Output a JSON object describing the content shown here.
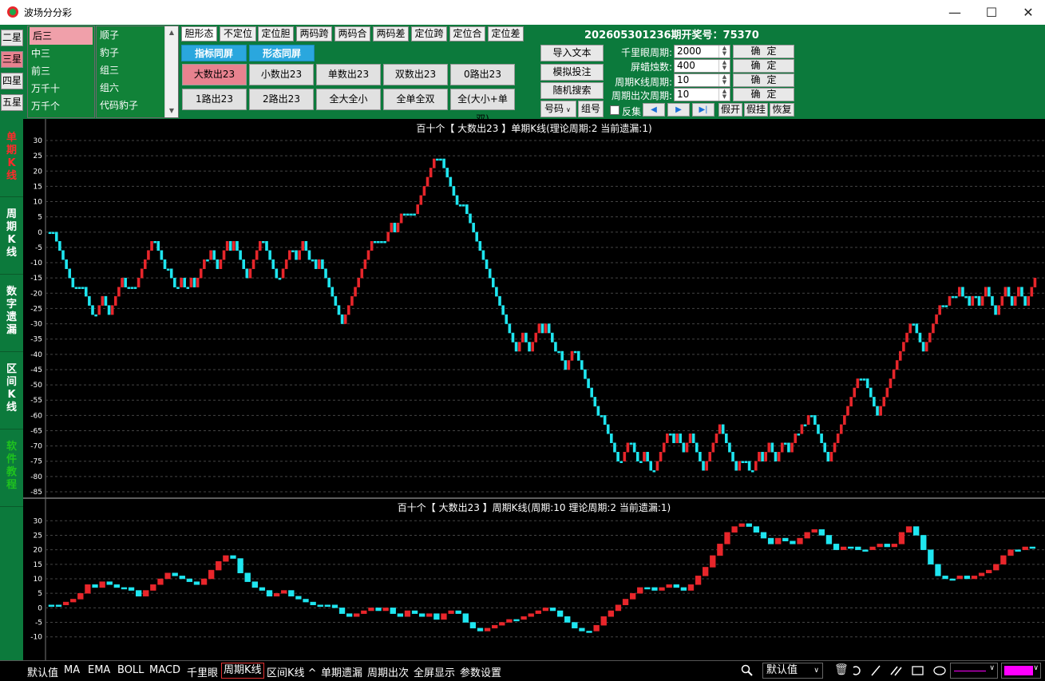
{
  "window": {
    "title": "波场分分彩",
    "min": "—",
    "max": "☐",
    "close": "✕"
  },
  "stars": [
    "二星",
    "三星",
    "四星",
    "五星"
  ],
  "list1": [
    "后三",
    "中三",
    "前三",
    "万千十",
    "万千个"
  ],
  "list2": [
    "顺子",
    "豹子",
    "组三",
    "组六",
    "代码豹子"
  ],
  "tabs": [
    "胆形态",
    "不定位",
    "定位胆",
    "两码跨",
    "两码合",
    "两码差",
    "定位跨",
    "定位合",
    "定位差"
  ],
  "blue_buttons": [
    "指标同屏",
    "形态同屏"
  ],
  "grid_buttons": [
    [
      "大数出23",
      "小数出23",
      "单数出23",
      "双数出23",
      "0路出23"
    ],
    [
      "1路出23",
      "2路出23",
      "全大全小",
      "全单全双",
      "全(大小+单双)"
    ]
  ],
  "period_label": "202605301236期开奖号：75370",
  "right_buttons": {
    "import": "导入文本",
    "simulate": "模拟投注",
    "random": "随机搜索",
    "number": "号码",
    "group": "组号"
  },
  "settings": [
    {
      "label": "千里眼周期:",
      "value": "2000",
      "ok": "确定"
    },
    {
      "label": "屏蜡烛数:",
      "value": "400",
      "ok": "确定"
    },
    {
      "label": "周期K线周期:",
      "value": "10",
      "ok": "确定"
    },
    {
      "label": "周期出次周期:",
      "value": "10",
      "ok": "确定"
    }
  ],
  "reverse_label": "反集",
  "small_buttons": [
    "假开",
    "假挂",
    "恢复"
  ],
  "vtabs": [
    {
      "label": "单期K线",
      "color": "#ff2b2b"
    },
    {
      "label": "周期K线",
      "color": "#ffffff"
    },
    {
      "label": "数字遗漏",
      "color": "#ffffff"
    },
    {
      "label": "区间K线",
      "color": "#ffffff"
    },
    {
      "label": "软件教程",
      "color": "#1fc21f"
    }
  ],
  "colors": {
    "up": "#e8262b",
    "down": "#1fe6f0",
    "grid": "#444444",
    "axis": "#ffffff"
  },
  "chart_data": [
    {
      "type": "line",
      "title": "百十个【 大数出23 】单期K线(理论周期:2 当前遗漏:1)",
      "ylim": [
        -85,
        30
      ],
      "yticks": [
        30,
        25,
        20,
        15,
        10,
        5,
        0,
        -5,
        -10,
        -15,
        -20,
        -25,
        -30,
        -35,
        -40,
        -45,
        -50,
        -55,
        -60,
        -65,
        -70,
        -75,
        -80,
        -85
      ],
      "series": [
        {
          "values": [
            0,
            0,
            -3,
            -6,
            -9,
            -12,
            -15,
            -18,
            -18,
            -18,
            -18,
            -21,
            -24,
            -27,
            -27,
            -24,
            -21,
            -24,
            -27,
            -24,
            -21,
            -18,
            -15,
            -18,
            -18,
            -18,
            -18,
            -15,
            -12,
            -9,
            -6,
            -3,
            -3,
            -6,
            -9,
            -12,
            -12,
            -15,
            -18,
            -18,
            -15,
            -18,
            -18,
            -15,
            -18,
            -15,
            -12,
            -9,
            -9,
            -6,
            -9,
            -12,
            -9,
            -6,
            -3,
            -6,
            -3,
            -6,
            -9,
            -12,
            -15,
            -12,
            -9,
            -6,
            -3,
            -3,
            -6,
            -9,
            -12,
            -15,
            -15,
            -12,
            -9,
            -6,
            -6,
            -9,
            -6,
            -3,
            -6,
            -9,
            -9,
            -12,
            -9,
            -12,
            -15,
            -18,
            -21,
            -24,
            -27,
            -30,
            -27,
            -24,
            -21,
            -18,
            -15,
            -12,
            -9,
            -6,
            -3,
            -3,
            -3,
            -3,
            -3,
            0,
            3,
            0,
            3,
            6,
            6,
            6,
            6,
            6,
            9,
            12,
            15,
            18,
            21,
            24,
            24,
            24,
            21,
            18,
            15,
            12,
            9,
            9,
            9,
            6,
            3,
            0,
            -3,
            -6,
            -9,
            -12,
            -15,
            -18,
            -21,
            -24,
            -27,
            -30,
            -33,
            -36,
            -39,
            -36,
            -33,
            -36,
            -39,
            -36,
            -33,
            -30,
            -33,
            -30,
            -33,
            -36,
            -39,
            -39,
            -42,
            -45,
            -42,
            -39,
            -39,
            -42,
            -45,
            -48,
            -51,
            -54,
            -57,
            -60,
            -60,
            -63,
            -66,
            -69,
            -72,
            -75,
            -75,
            -72,
            -69,
            -69,
            -72,
            -75,
            -75,
            -72,
            -75,
            -78,
            -78,
            -75,
            -72,
            -69,
            -66,
            -66,
            -69,
            -66,
            -69,
            -72,
            -69,
            -66,
            -69,
            -72,
            -75,
            -78,
            -75,
            -72,
            -69,
            -66,
            -63,
            -66,
            -69,
            -72,
            -75,
            -78,
            -75,
            -75,
            -75,
            -78,
            -78,
            -75,
            -72,
            -75,
            -72,
            -69,
            -72,
            -75,
            -72,
            -69,
            -69,
            -72,
            -69,
            -66,
            -66,
            -63,
            -63,
            -60,
            -60,
            -63,
            -66,
            -69,
            -72,
            -75,
            -72,
            -69,
            -66,
            -63,
            -60,
            -57,
            -54,
            -51,
            -48,
            -48,
            -48,
            -51,
            -54,
            -57,
            -60,
            -57,
            -54,
            -51,
            -48,
            -45,
            -42,
            -39,
            -36,
            -33,
            -30,
            -30,
            -33,
            -36,
            -39,
            -36,
            -33,
            -30,
            -27,
            -24,
            -24,
            -24,
            -21,
            -21,
            -21,
            -18,
            -21,
            -21,
            -24,
            -21,
            -21,
            -24,
            -21,
            -18,
            -21,
            -24,
            -27,
            -24,
            -21,
            -18,
            -21,
            -24,
            -21,
            -18,
            -21,
            -24,
            -21,
            -18,
            -15
          ]
        }
      ]
    },
    {
      "type": "line",
      "title": "百十个【 大数出23 】周期K线(周期:10 理论周期:2 当前遗漏:1)",
      "ylim": [
        -12,
        32
      ],
      "yticks": [
        30,
        25,
        20,
        15,
        10,
        5,
        0,
        -5,
        -10
      ],
      "series": [
        {
          "values": [
            1,
            1,
            2,
            3,
            5,
            8,
            7,
            9,
            8,
            7,
            7,
            6,
            4,
            6,
            8,
            10,
            12,
            11,
            10,
            9,
            8,
            10,
            13,
            16,
            18,
            17,
            12,
            9,
            7,
            6,
            4,
            5,
            6,
            4,
            3,
            2,
            1,
            1,
            1,
            0,
            -2,
            -3,
            -2,
            -1,
            0,
            -1,
            0,
            -2,
            -3,
            -1,
            -2,
            -3,
            -2,
            -4,
            -2,
            -1,
            -2,
            -5,
            -7,
            -8,
            -7,
            -6,
            -5,
            -4,
            -4,
            -3,
            -2,
            -1,
            0,
            -1,
            -3,
            -5,
            -7,
            -8,
            -8,
            -6,
            -3,
            -1,
            1,
            3,
            5,
            7,
            7,
            6,
            7,
            8,
            7,
            6,
            8,
            11,
            14,
            18,
            22,
            26,
            28,
            29,
            28,
            26,
            24,
            22,
            24,
            23,
            22,
            24,
            26,
            27,
            25,
            22,
            20,
            21,
            21,
            20,
            20,
            21,
            22,
            21,
            22,
            26,
            28,
            25,
            20,
            15,
            11,
            10,
            10,
            11,
            10,
            11,
            12,
            13,
            15,
            18,
            20,
            20,
            21,
            21
          ]
        }
      ]
    }
  ],
  "bottom": [
    "默认值",
    "MA",
    "EMA",
    "BOLL",
    "MACD",
    "千里眼",
    "周期K线",
    "区间K线 ^",
    "单期遗漏",
    "周期出次",
    "全屏显示",
    "参数设置"
  ],
  "bottom_right": {
    "select": "默认值"
  }
}
